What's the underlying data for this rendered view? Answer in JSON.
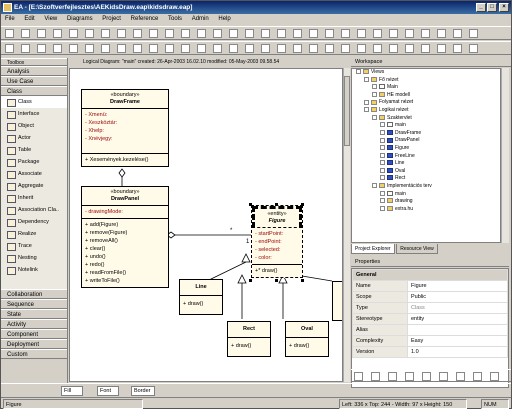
{
  "window": {
    "title": "EA - [E:\\Szoftverfejlesztes\\AEKidsDraw.eap\\kidsdraw.eap]",
    "min_glyph": "_",
    "max_glyph": "□",
    "close_glyph": "×"
  },
  "menu": [
    "File",
    "Edit",
    "View",
    "Diagrams",
    "Project",
    "Reference",
    "Tools",
    "Admin",
    "Help"
  ],
  "toolbox": {
    "header": "Toolbox",
    "groups_top": [
      "Analysis",
      "Use Case",
      "Class"
    ],
    "items": [
      "Class",
      "Interface",
      "Object",
      "Actor",
      "Table",
      "Package",
      "Associate",
      "Aggregate",
      "Inherit",
      "Association Cla..",
      "Dependency",
      "Realize",
      "Trace",
      "Nesting",
      "Notelink"
    ],
    "groups_bottom": [
      "Collaboration",
      "Sequence",
      "State",
      "Activity",
      "Component",
      "Deployment",
      "Custom"
    ]
  },
  "diagram_info": "Logical Diagram: \"main\"   created: 26-Apr-2003 16.02.10   modified: 05-May-2003 09.58.54",
  "classes": {
    "drawframe": {
      "stereotype": "«boundary»",
      "name": "DrawFrame",
      "attributes": [
        "- Xmenü:",
        "- Xeszköztár:",
        "- Xhelp:",
        "- Xnévjegy:"
      ],
      "operations": [
        "+  Xesemények.kezelése()"
      ]
    },
    "drawpanel": {
      "stereotype": "«boundary»",
      "name": "DrawPanel",
      "attributes": [
        "-  drawingMode:"
      ],
      "operations": [
        "+  add(Figure)",
        "+  remove(Figure)",
        "+  removeAll()",
        "+  clear()",
        "+  undo()",
        "+  redo()",
        "+  readFromFile()",
        "+  writeToFile()"
      ]
    },
    "figure": {
      "stereotype": "«entity»",
      "name": "Figure",
      "attributes": [
        "-  startPoint:",
        "-  endPoint:",
        "-  selected:",
        "-  color:"
      ],
      "operations": [
        "+*  draw()"
      ]
    },
    "line": {
      "name": "Line",
      "operations": [
        "+  draw()"
      ]
    },
    "rect": {
      "name": "Rect",
      "operations": [
        "+  draw()"
      ]
    },
    "oval": {
      "name": "Oval",
      "operations": [
        "+  draw()"
      ]
    }
  },
  "multiplicity_star": "*",
  "multiplicity_one": "1",
  "workspace": {
    "header": "Workspace",
    "tree": [
      {
        "depth": 0,
        "icon": "pkg",
        "label": "Views"
      },
      {
        "depth": 1,
        "icon": "pkg",
        "label": "Fő nézet"
      },
      {
        "depth": 2,
        "icon": "dg",
        "label": "Main"
      },
      {
        "depth": 2,
        "icon": "pkg",
        "label": "HE modell"
      },
      {
        "depth": 1,
        "icon": "pkg",
        "label": "Folyamat nézet"
      },
      {
        "depth": 1,
        "icon": "pkg",
        "label": "Logikai nézet"
      },
      {
        "depth": 2,
        "icon": "pkg",
        "label": "Szaktervlet"
      },
      {
        "depth": 3,
        "icon": "dg",
        "label": "main"
      },
      {
        "depth": 3,
        "icon": "cl",
        "label": "DrawFrame"
      },
      {
        "depth": 3,
        "icon": "cl",
        "label": "DrawPanel"
      },
      {
        "depth": 3,
        "icon": "cl",
        "label": "Figure"
      },
      {
        "depth": 3,
        "icon": "cl",
        "label": "FreeLine"
      },
      {
        "depth": 3,
        "icon": "cl",
        "label": "Line"
      },
      {
        "depth": 3,
        "icon": "cl",
        "label": "Oval"
      },
      {
        "depth": 3,
        "icon": "cl",
        "label": "Rect"
      },
      {
        "depth": 2,
        "icon": "pkg",
        "label": "Implementációs terv"
      },
      {
        "depth": 3,
        "icon": "dg",
        "label": "main"
      },
      {
        "depth": 3,
        "icon": "pkg",
        "label": "drawing"
      },
      {
        "depth": 3,
        "icon": "pkg",
        "label": "extra.hu"
      }
    ],
    "tabs": [
      "Project Explorer",
      "Resource View"
    ]
  },
  "properties": {
    "header": "Properties",
    "group": "General",
    "rows": [
      {
        "k": "Name",
        "v": "Figure"
      },
      {
        "k": "Scope",
        "v": "Public"
      },
      {
        "k": "Type",
        "v": "Class"
      },
      {
        "k": "Stereotype",
        "v": "entity"
      },
      {
        "k": "Alias",
        "v": ""
      },
      {
        "k": "Complexity",
        "v": "Easy"
      },
      {
        "k": "Version",
        "v": "1.0"
      }
    ]
  },
  "format": {
    "fill": "Fill",
    "font": "Font",
    "border": "Border"
  },
  "status": {
    "left": "Figure",
    "pos": "Left: 336 x Top: 244 - Width: 97 x Height: 150",
    "mode": "NUM"
  }
}
